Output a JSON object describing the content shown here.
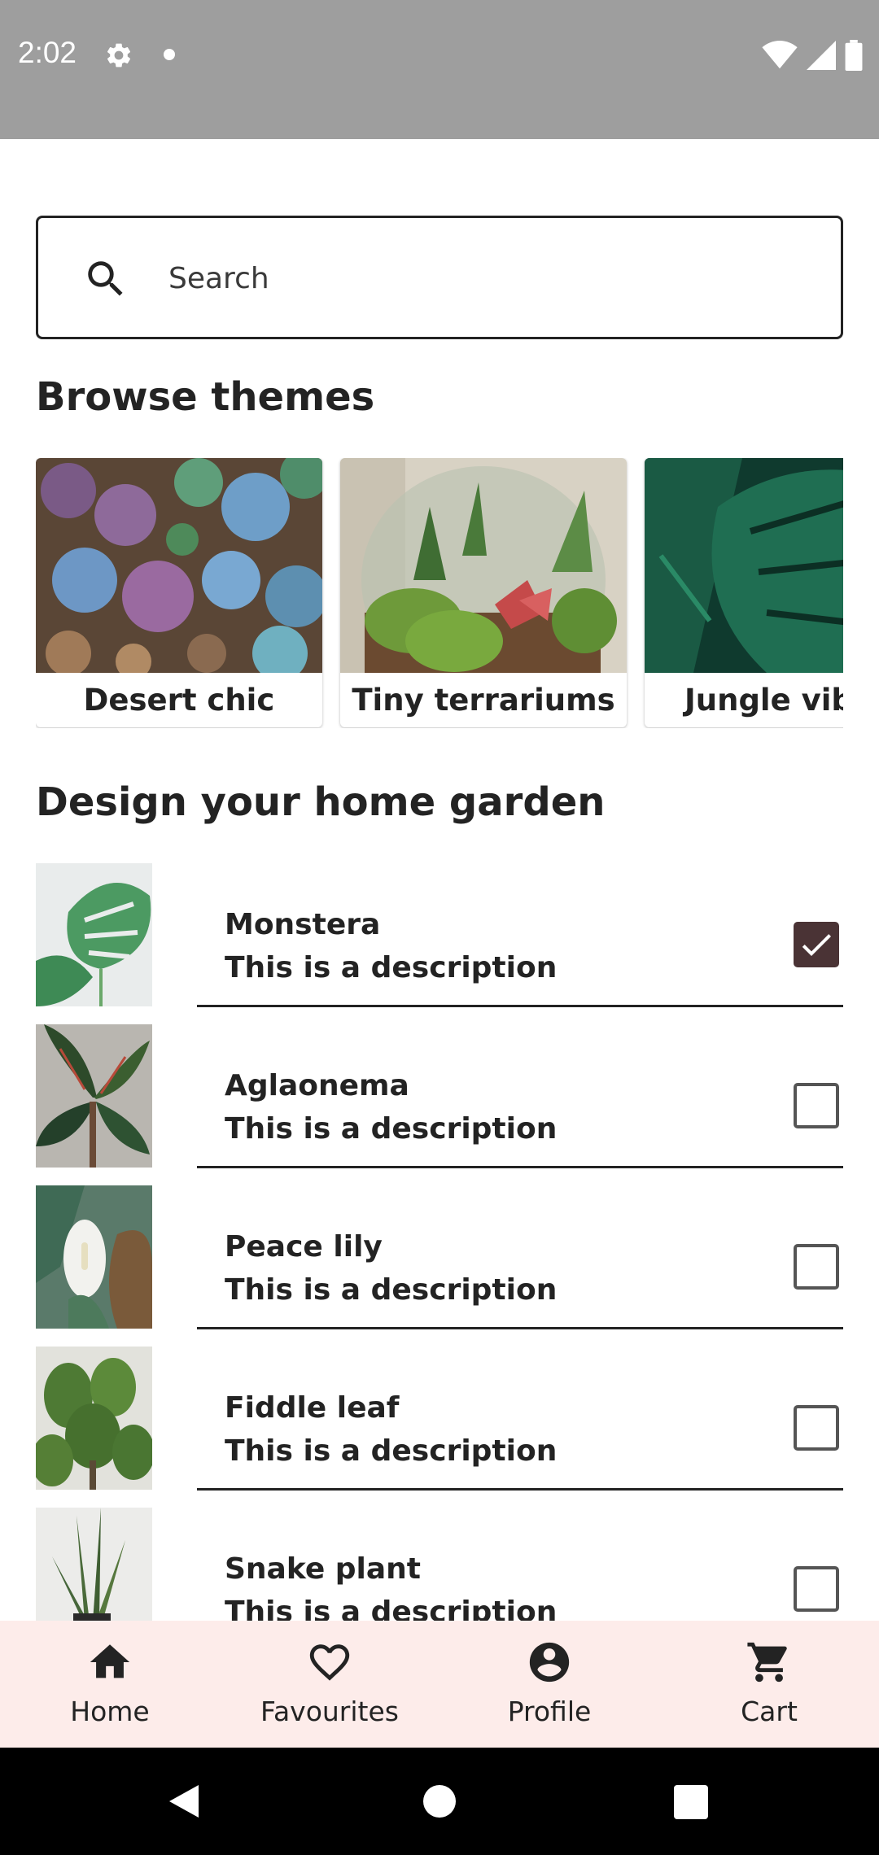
{
  "status_bar": {
    "time": "2:02",
    "left_icons": [
      "gear-icon",
      "notification-dot-icon"
    ],
    "right_icons": [
      "wifi-icon",
      "cell-signal-icon",
      "battery-icon"
    ],
    "background": "#9e9e9e"
  },
  "search": {
    "placeholder": "Search",
    "icon": "search-icon"
  },
  "browse_themes": {
    "title": "Browse themes",
    "items": [
      {
        "label": "Desert chic",
        "image": "succulents-photo"
      },
      {
        "label": "Tiny terrariums",
        "image": "terrarium-photo"
      },
      {
        "label": "Jungle vibes",
        "image": "monstera-leaves-photo"
      }
    ]
  },
  "garden": {
    "title": "Design your home garden",
    "items": [
      {
        "name": "Monstera",
        "description": "This is a description",
        "checked": true
      },
      {
        "name": "Aglaonema",
        "description": "This is a description",
        "checked": false
      },
      {
        "name": "Peace lily",
        "description": "This is a description",
        "checked": false
      },
      {
        "name": "Fiddle leaf",
        "description": "This is a description",
        "checked": false
      },
      {
        "name": "Snake plant",
        "description": "This is a description",
        "checked": false
      }
    ]
  },
  "bottom_nav": {
    "items": [
      {
        "label": "Home",
        "icon": "home-icon"
      },
      {
        "label": "Favourites",
        "icon": "heart-icon"
      },
      {
        "label": "Profile",
        "icon": "account-circle-icon"
      },
      {
        "label": "Cart",
        "icon": "cart-icon"
      }
    ],
    "background": "#fdecea"
  },
  "system_nav": {
    "icons": [
      "back-icon",
      "home-circle-icon",
      "recents-icon"
    ]
  },
  "colors": {
    "text": "#232323",
    "checkbox_checked": "#4a3335"
  }
}
